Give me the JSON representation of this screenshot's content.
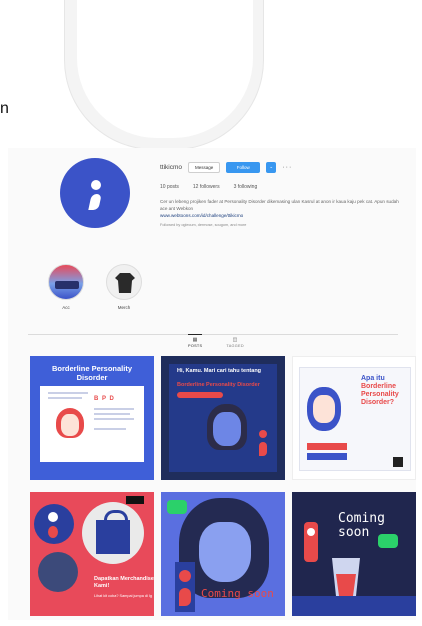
{
  "edge_text": "n",
  "profile": {
    "username": "ttikicmo",
    "buttons": {
      "message": "Message",
      "follow": "Follow",
      "dropdown": "⌄",
      "more": "···"
    },
    "stats": {
      "posts": "10 posts",
      "followers": "12 followers",
      "following": "3 following"
    },
    "bio": "Cer un lebeng projiken fader at Personality Disorder dikemasing ulan Kasrul at anon ir kaua kaju pek cat. Apun sudah ace ant Webkon",
    "link": "www.webtoons.com/id/challenge/ttikicmo",
    "followed_by": "Followed by oglecum, dermose, sougom, and more"
  },
  "highlights": [
    {
      "label": "Acc"
    },
    {
      "label": "Merch"
    }
  ],
  "tabs": [
    {
      "label": "POSTS",
      "icon": "grid-icon"
    },
    {
      "label": "TAGGED",
      "icon": "tag-icon"
    }
  ],
  "posts": {
    "p1": {
      "title": "Borderline Personality Disorder",
      "acronym": "B P D"
    },
    "p2": {
      "title": "Hi, Kamu. Mari cari tahu tentang",
      "highlight": "Borderline Personality Disorder"
    },
    "p3": {
      "title_a": "Apa itu",
      "title_b": "Borderline Personality Disorder?"
    },
    "p4": {
      "title": "Dapatkan Merchandise Kami!",
      "small": "Lihat kit coba? Sampai jumpa di Ig"
    },
    "p5": {
      "text": "Coming soon"
    },
    "p6": {
      "text": "Coming soon"
    }
  },
  "colors": {
    "brand_blue": "#3b53c8",
    "accent_red": "#e84a4a",
    "follow_blue": "#3897f0"
  }
}
